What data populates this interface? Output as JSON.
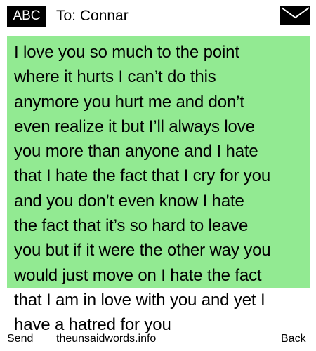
{
  "header": {
    "mode_label": "ABC",
    "recipient": "To: Connar",
    "icon": "envelope-icon"
  },
  "message": {
    "lines": [
      "I love you so much to the point",
      "where it hurts I can’t do this",
      "anymore you hurt me and don’t",
      "even realize it but I’ll always love",
      "you more than anyone and I hate",
      "that I hate the fact that I cry for you",
      "and you don’t even know I hate",
      "the fact that it’s so hard to leave",
      "you but if it were the other way you",
      "would just move on I hate the fact",
      "that I am in love with you and yet I",
      "have a hatred for you"
    ],
    "highlight_color": "#92ea92"
  },
  "footer": {
    "left_key": "Send",
    "center_text": "theunsaidwords.info",
    "right_key": "Back"
  }
}
